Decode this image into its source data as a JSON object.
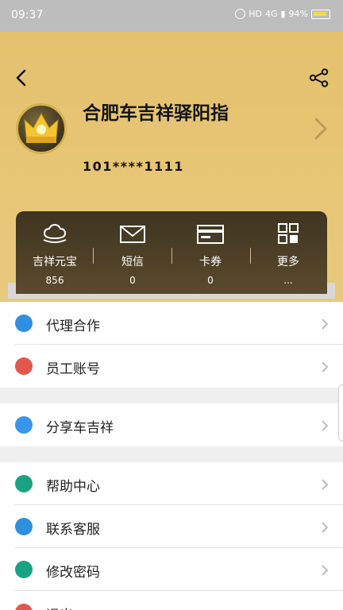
{
  "status": {
    "time": "09:37",
    "network": "HD",
    "signal": "4G",
    "battery": "94%"
  },
  "profile": {
    "name": "合肥车吉祥驿阳指",
    "account": "101****1111"
  },
  "stats": [
    {
      "label": "吉祥元宝",
      "value": "856",
      "icon": "gold-ingot-icon"
    },
    {
      "label": "短信",
      "value": "0",
      "icon": "envelope-icon"
    },
    {
      "label": "卡券",
      "value": "0",
      "icon": "card-icon"
    },
    {
      "label": "更多",
      "value": "...",
      "icon": "grid-icon"
    }
  ],
  "menu": {
    "group1": [
      {
        "label": "代理合作",
        "icon": "handshake-icon",
        "color": "#2f8fe0"
      },
      {
        "label": "员工账号",
        "icon": "person-icon",
        "color": "#e2574c"
      }
    ],
    "group2": [
      {
        "label": "分享车吉祥",
        "icon": "share-icon",
        "color": "#3a95e8"
      }
    ],
    "group3": [
      {
        "label": "帮助中心",
        "icon": "info-icon",
        "color": "#1aa382"
      },
      {
        "label": "联系客服",
        "icon": "phone-icon",
        "color": "#2f8fe0"
      },
      {
        "label": "修改密码",
        "icon": "lock-icon",
        "color": "#1aa382"
      },
      {
        "label": "退出",
        "icon": "logout-icon",
        "color": "#e2574c"
      }
    ]
  },
  "colors": {
    "hero": "#e4c16d",
    "card": "#4a3d25",
    "accent": "#2f8fe0"
  }
}
